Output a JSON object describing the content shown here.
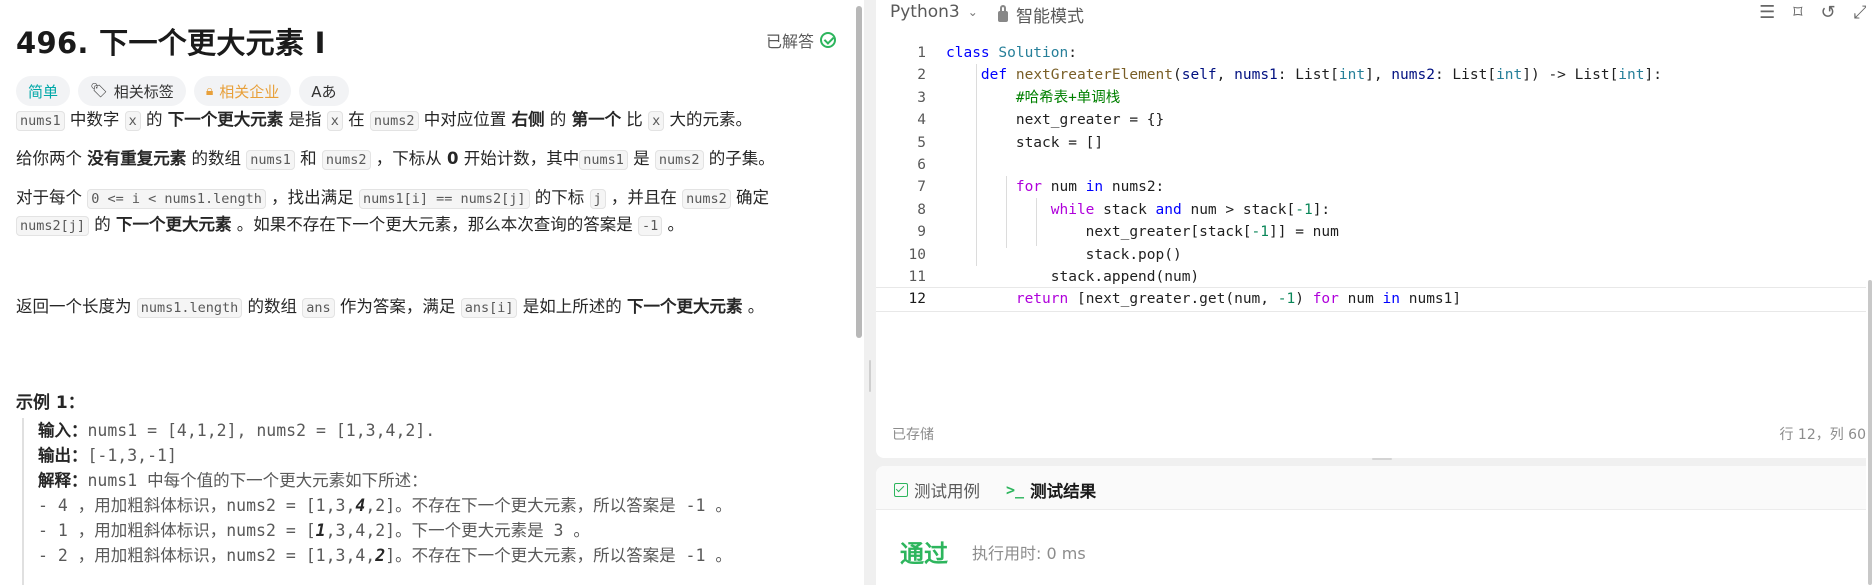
{
  "problem": {
    "title": "496. 下一个更大元素 I",
    "solved_label": "已解答",
    "tags": {
      "difficulty": "简单",
      "related_tags": "相关标签",
      "related_companies": "相关企业",
      "translate": "Aあ"
    },
    "p1": {
      "c1": "nums1",
      "t1": " 中数字 ",
      "c2": "x",
      "t2": " 的 ",
      "b1": "下一个更大元素",
      "t3": " 是指 ",
      "c3": "x",
      "t4": " 在 ",
      "c4": "nums2",
      "t5": " 中对应位置 ",
      "b2": "右侧",
      "t6": " 的 ",
      "b3": "第一个",
      "t7": " 比 ",
      "c5": "x",
      "t8": " 大的元素。"
    },
    "p2": {
      "t1": "给你两个 ",
      "b1": "没有重复元素",
      "t2": " 的数组 ",
      "c1": "nums1",
      "t3": " 和 ",
      "c2": "nums2",
      "t4": " ，下标从 ",
      "b2": "0",
      "t5": " 开始计数，其中",
      "c3": "nums1",
      "t6": " 是 ",
      "c4": "nums2",
      "t7": " 的子集。"
    },
    "p3": {
      "t1": "对于每个 ",
      "c1": "0 <= i < nums1.length",
      "t2": " ，找出满足 ",
      "c2": "nums1[i] == nums2[j]",
      "t3": " 的下标 ",
      "c3": "j",
      "t4": " ，并且在 ",
      "c4": "nums2",
      "t5": " 确定",
      "c5": "nums2[j]",
      "t6": " 的 ",
      "b1": "下一个更大元素",
      "t7": " 。如果不存在下一个更大元素，那么本次查询的答案是 ",
      "c6": "-1",
      "t8": " 。"
    },
    "p4": {
      "t1": "返回一个长度为 ",
      "c1": "nums1.length",
      "t2": " 的数组 ",
      "c2": "ans",
      "t3": " 作为答案，满足 ",
      "c3": "ans[i]",
      "t4": " 是如上所述的 ",
      "b1": "下一个更大元素",
      "t5": " 。"
    },
    "example": {
      "title": "示例 1：",
      "input_label": "输入：",
      "input_value": "nums1 = [4,1,2], nums2 = [1,3,4,2].",
      "output_label": "输出：",
      "output_value": "[-1,3,-1]",
      "explain_label": "解释：",
      "explain_text": "nums1 中每个值的下一个更大元素如下所述：",
      "l1a": "- 4 ，用加粗斜体标识，nums2 = [1,3,",
      "l1b": "4",
      "l1c": ",2]。不存在下一个更大元素，所以答案是 -1 。",
      "l2a": "- 1 ，用加粗斜体标识，nums2 = [",
      "l2b": "1",
      "l2c": ",3,4,2]。下一个更大元素是 3 。",
      "l3a": "- 2 ，用加粗斜体标识，nums2 = [1,3,4,",
      "l3b": "2",
      "l3c": "]。不存在下一个更大元素，所以答案是 -1 。"
    }
  },
  "editor": {
    "language": "Python3",
    "mode": "智能模式",
    "toolbar_icons": [
      "format-icon",
      "bookmark-icon",
      "reset-icon",
      "expand-icon"
    ],
    "line_numbers": [
      "1",
      "2",
      "3",
      "4",
      "5",
      "6",
      "7",
      "8",
      "9",
      "10",
      "11",
      "12"
    ],
    "status": "已存储",
    "cursor": "行 12，列 60"
  },
  "results": {
    "tab_cases": "测试用例",
    "tab_result": "测试结果",
    "verdict": "通过",
    "runtime": "执行用时: 0 ms"
  },
  "colors": {
    "accent_green": "#2db55d",
    "easy": "#00a8a8",
    "company": "#e8a03a"
  }
}
